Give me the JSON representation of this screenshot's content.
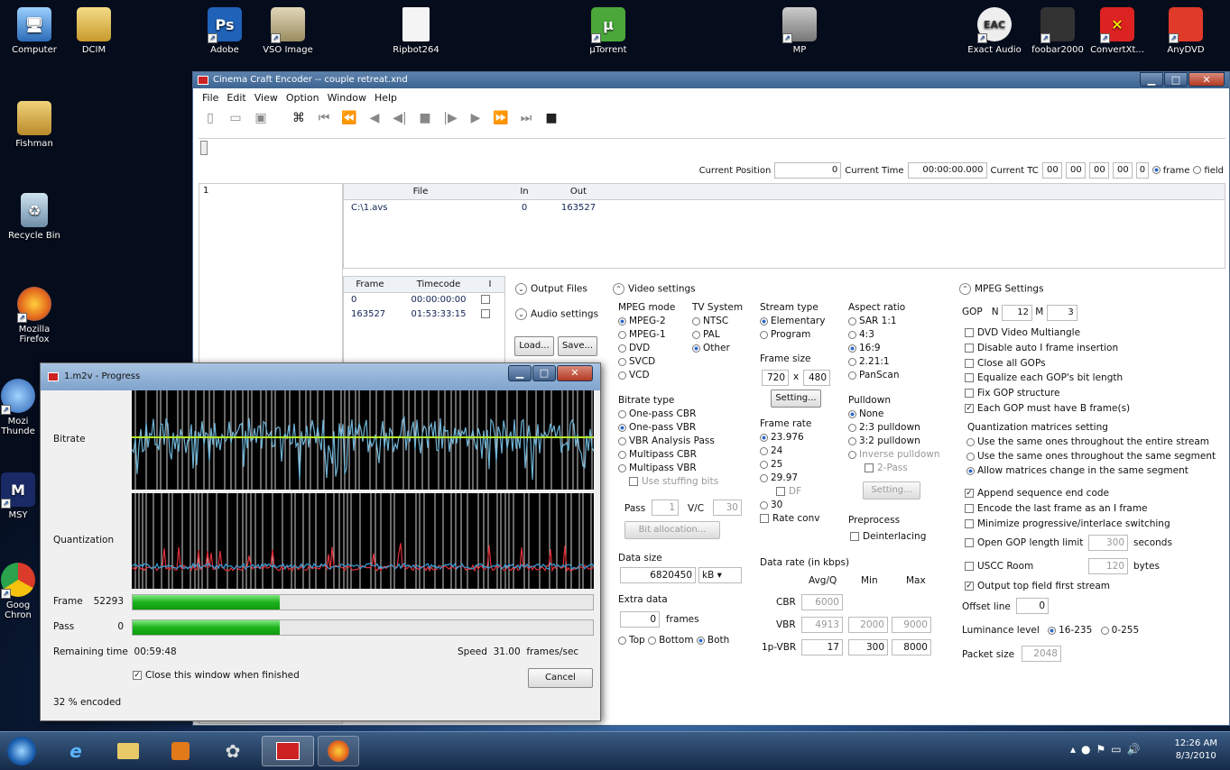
{
  "desktop_icons": [
    {
      "label": "Computer",
      "icon": "computer-icon"
    },
    {
      "label": "DCIM",
      "icon": "folder-icon"
    },
    {
      "label": "Adobe",
      "icon": "photoshop-icon",
      "glyph": "Ps"
    },
    {
      "label": "VSO Image",
      "icon": "vso-image-icon"
    },
    {
      "label": "Ripbot264",
      "icon": "document-icon"
    },
    {
      "label": "µTorrent",
      "icon": "utorrent-icon",
      "glyph": "µ"
    },
    {
      "label": "MP",
      "icon": "mp-icon"
    },
    {
      "label": "Exact Audio",
      "icon": "eac-icon",
      "glyph": "EAC"
    },
    {
      "label": "foobar2000",
      "icon": "foobar-icon"
    },
    {
      "label": "ConvertXt...",
      "icon": "convertx-icon"
    },
    {
      "label": "AnyDVD",
      "icon": "anydvd-icon"
    },
    {
      "label": "Fishman",
      "icon": "user-folder-icon"
    },
    {
      "label": "Recycle Bin",
      "icon": "recycle-bin-icon"
    },
    {
      "label": "Mozilla Firefox",
      "icon": "firefox-icon"
    },
    {
      "label": "Mozi Thunde",
      "icon": "thunderbird-icon"
    },
    {
      "label": "MSY",
      "icon": "msy-icon"
    },
    {
      "label": "Goog Chron",
      "icon": "chrome-icon"
    }
  ],
  "cce": {
    "title": "Cinema Craft Encoder -- couple retreat.xnd",
    "menu": [
      "File",
      "Edit",
      "View",
      "Option",
      "Window",
      "Help"
    ],
    "position": {
      "current_position_label": "Current Position",
      "current_position": "0",
      "current_time_label": "Current Time",
      "current_time": "00:00:00.000",
      "current_tc_label": "Current TC",
      "tc": [
        "00",
        "00",
        "00",
        "00",
        "0"
      ],
      "frame_label": "frame",
      "field_label": "field"
    },
    "list_item": "1",
    "file_table": {
      "headers": [
        "File",
        "In",
        "Out"
      ],
      "rows": [
        [
          "C:\\1.avs",
          "0",
          "163527"
        ]
      ]
    },
    "frame_table": {
      "headers": [
        "Frame",
        "Timecode",
        "I"
      ],
      "rows": [
        [
          "0",
          "00:00:00:00"
        ],
        [
          "163527",
          "01:53:33:15"
        ]
      ]
    },
    "output_files": "Output Files",
    "audio_settings": "Audio settings",
    "load": "Load...",
    "save": "Save...",
    "video_settings": {
      "title": "Video settings",
      "mpeg_mode_label": "MPEG mode",
      "mpeg_modes": [
        "MPEG-2",
        "MPEG-1",
        "DVD",
        "SVCD",
        "VCD"
      ],
      "tv_label": "TV System",
      "tv_systems": [
        "NTSC",
        "PAL",
        "Other"
      ],
      "stream_label": "Stream type",
      "streams": [
        "Elementary",
        "Program"
      ],
      "aspect_label": "Aspect ratio",
      "aspects": [
        "SAR 1:1",
        "4:3",
        "16:9",
        "2.21:1",
        "PanScan"
      ],
      "frame_size_label": "Frame size",
      "width": "720",
      "x": "x",
      "height": "480",
      "setting": "Setting...",
      "bitrate_label": "Bitrate type",
      "bitrates": [
        "One-pass CBR",
        "One-pass VBR",
        "VBR Analysis Pass",
        "Multipass CBR",
        "Multipass VBR"
      ],
      "stuffing": "Use stuffing bits",
      "framerate_label": "Frame rate",
      "framerates": [
        "23.976",
        "24",
        "25",
        "29.97"
      ],
      "df": "DF",
      "fr30": "30",
      "rate_conv": "Rate conv",
      "pulldown_label": "Pulldown",
      "pulldowns": [
        "None",
        "2:3 pulldown",
        "3:2 pulldown",
        "Inverse pulldown"
      ],
      "two_pass": "2-Pass",
      "pd_setting": "Setting...",
      "pass_label": "Pass",
      "pass": "1",
      "vc_label": "V/C",
      "vc": "30",
      "bit_alloc": "Bit allocation...",
      "preprocess_label": "Preprocess",
      "deinterlacing": "Deinterlacing",
      "data_size_label": "Data size",
      "data_size": "6820450",
      "unit": "kB",
      "data_rate_label": "Data rate (in kbps)",
      "avgq": "Avg/Q",
      "min": "Min",
      "max": "Max",
      "cbr_label": "CBR",
      "cbr": "6000",
      "vbr_label": "VBR",
      "vbr": [
        "4913",
        "2000",
        "9000"
      ],
      "onep_label": "1p-VBR",
      "onep": [
        "17",
        "300",
        "8000"
      ],
      "extra_label": "Extra data",
      "extra": "0",
      "frames": "frames",
      "top": "Top",
      "bottom": "Bottom",
      "both": "Both"
    },
    "mpeg_settings": {
      "title": "MPEG Settings",
      "gop": "GOP",
      "n_label": "N",
      "n": "12",
      "m_label": "M",
      "m": "3",
      "checks1": [
        {
          "label": "DVD Video Multiangle",
          "checked": false
        },
        {
          "label": "Disable auto I frame insertion",
          "checked": false
        },
        {
          "label": "Close all GOPs",
          "checked": false
        },
        {
          "label": "Equalize each GOP's bit length",
          "checked": false
        },
        {
          "label": "Fix GOP structure",
          "checked": false
        },
        {
          "label": "Each GOP must have B frame(s)",
          "checked": true
        }
      ],
      "quant_title": "Quantization matrices setting",
      "quant": [
        "Use the same ones throughout the entire stream",
        "Use the same ones throughout the same segment",
        "Allow matrices change in the same segment"
      ],
      "checks2": [
        {
          "label": "Append sequence end code",
          "checked": true
        },
        {
          "label": "Encode the last frame as an I frame",
          "checked": false
        },
        {
          "label": "Minimize progressive/interlace switching",
          "checked": false
        }
      ],
      "open_gop": "Open GOP length limit",
      "open_gop_val": "300",
      "seconds": "seconds",
      "uscc": "USCC Room",
      "uscc_val": "120",
      "bytes": "bytes",
      "top_field": "Output top field first stream",
      "offset": "Offset line",
      "offset_val": "0",
      "lum": "Luminance level",
      "lum1": "16-235",
      "lum2": "0-255",
      "packet": "Packet size",
      "packet_val": "2048"
    }
  },
  "progress": {
    "title": "1.m2v - Progress",
    "bitrate": "Bitrate",
    "quantization": "Quantization",
    "frame_label": "Frame",
    "frame": "52293",
    "pass_label": "Pass",
    "pass": "0",
    "remaining_label": "Remaining time",
    "remaining": "00:59:48",
    "speed_label": "Speed",
    "speed": "31.00",
    "speed_unit": "frames/sec",
    "close_when_finished": "Close this window when finished",
    "cancel": "Cancel",
    "status": "32 % encoded",
    "frame_progress": 0.32,
    "pass_progress": 0.32
  },
  "taskbar": {
    "time": "12:26 AM",
    "date": "8/3/2010"
  },
  "colors": {
    "bitrate_line": "#6fb4d6",
    "bitrate_avg": "#b6e626",
    "quant_red": "#e0303a",
    "quant_blue": "#36a0d8",
    "progress_green": "#1db21d"
  }
}
